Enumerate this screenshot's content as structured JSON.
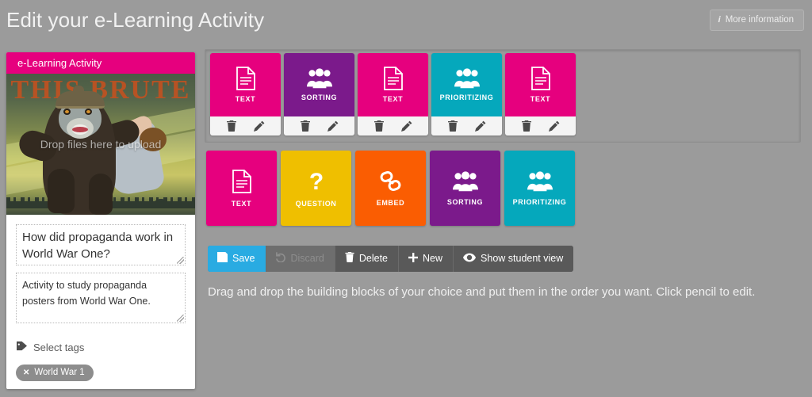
{
  "header": {
    "title": "Edit your e-Learning Activity",
    "more_info_label": "More information",
    "more_info_icon": "info-icon"
  },
  "activity_card": {
    "header_label": "e-Learning Activity",
    "image_drop_text": "Drop files here to upload",
    "poster_caption": "THIS BRUTE",
    "title_value": "How did propaganda work in World War One?",
    "description_value": "Activity to study propaganda posters from World War One.",
    "tags_label": "Select tags",
    "tags_icon": "tag-icon",
    "tags": [
      {
        "label": "World War 1",
        "remove_icon": "close-icon"
      }
    ]
  },
  "sequence": {
    "block_action_delete_icon": "trash-icon",
    "block_action_edit_icon": "pencil-icon",
    "blocks": [
      {
        "label": "TEXT",
        "type": "text",
        "icon": "document-icon",
        "color": "#e6007e"
      },
      {
        "label": "SORTING",
        "type": "sorting",
        "icon": "users-icon",
        "color": "#7b1a8b"
      },
      {
        "label": "TEXT",
        "type": "text",
        "icon": "document-icon",
        "color": "#e6007e"
      },
      {
        "label": "PRIORITIZING",
        "type": "prioritizing",
        "icon": "users-icon",
        "color": "#05a8bc"
      },
      {
        "label": "TEXT",
        "type": "text",
        "icon": "document-icon",
        "color": "#e6007e"
      }
    ]
  },
  "palette": {
    "tiles": [
      {
        "label": "TEXT",
        "type": "text",
        "icon": "document-icon",
        "color": "#e6007e"
      },
      {
        "label": "QUESTION",
        "type": "question",
        "icon": "question-icon",
        "color": "#efbf00"
      },
      {
        "label": "EMBED",
        "type": "embed",
        "icon": "link-icon",
        "color": "#fa5d02"
      },
      {
        "label": "SORTING",
        "type": "sorting",
        "icon": "users-icon",
        "color": "#7b1a8b"
      },
      {
        "label": "PRIORITIZING",
        "type": "prioritizing",
        "icon": "users-icon",
        "color": "#05a8bc"
      }
    ]
  },
  "toolbar": {
    "save_label": "Save",
    "save_icon": "floppy-icon",
    "discard_label": "Discard",
    "discard_icon": "undo-icon",
    "delete_label": "Delete",
    "delete_icon": "trash-icon",
    "new_label": "New",
    "new_icon": "plus-icon",
    "student_view_label": "Show student view",
    "student_view_icon": "eye-icon"
  },
  "hint": {
    "text": "Drag and drop the building blocks of your choice and put them in the order you want. Click pencil to edit."
  },
  "colors": {
    "background": "#9b9b9b",
    "magenta": "#e6007e",
    "purple": "#7b1a8b",
    "teal": "#05a8bc",
    "yellow": "#efbf00",
    "orange": "#fa5d02",
    "primary_blue": "#29abe2",
    "toolbar_gray": "#595959"
  }
}
